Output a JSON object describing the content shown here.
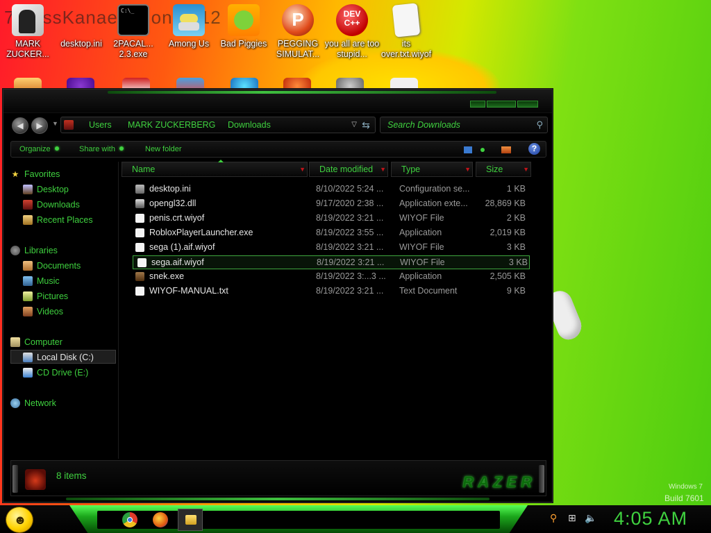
{
  "colors": {
    "accent_green": "#3fd13f",
    "window_bg": "#000000",
    "arrow_red": "#c0141a"
  },
  "background_text": "7...ossKanae ...tion 2012",
  "desktop_icons": [
    {
      "label": "MARK ZUCKER...",
      "icon": "user-folder-icon"
    },
    {
      "label": "desktop.ini",
      "icon": "cmd-icon"
    },
    {
      "label": "2PACAL... 2.3.exe",
      "icon": "terminal-icon"
    },
    {
      "label": "Among Us",
      "icon": "among-us-icon"
    },
    {
      "label": "Bad Piggies",
      "icon": "bad-piggies-icon"
    },
    {
      "label": "PEGGING SIMULAT...",
      "icon": "p-game-icon"
    },
    {
      "label": "you all are too stupid...",
      "icon": "dev-cpp-icon"
    },
    {
      "label": "its over.txt.wiyof",
      "icon": "blank-file-icon"
    }
  ],
  "nav": {
    "back": "◀",
    "forward": "▶",
    "breadcrumb": [
      "Users",
      "MARK ZUCKERBERG",
      "Downloads"
    ],
    "search_placeholder": "Search Downloads"
  },
  "toolbar": {
    "organize": "Organize",
    "share_with": "Share with",
    "new_folder": "New folder",
    "help": "?"
  },
  "sidebar": {
    "favorites": {
      "label": "Favorites",
      "items": [
        "Desktop",
        "Downloads",
        "Recent Places"
      ]
    },
    "libraries": {
      "label": "Libraries",
      "items": [
        "Documents",
        "Music",
        "Pictures",
        "Videos"
      ]
    },
    "computer": {
      "label": "Computer",
      "items": [
        "Local Disk (C:)",
        "CD Drive (E:)"
      ]
    },
    "network": {
      "label": "Network"
    }
  },
  "columns": {
    "name": "Name",
    "date": "Date modified",
    "type": "Type",
    "size": "Size"
  },
  "files": [
    {
      "name": "desktop.ini",
      "date": "8/10/2022 5:24 ...",
      "type": "Configuration se...",
      "size": "1 KB",
      "icon": "config-file-icon"
    },
    {
      "name": "opengl32.dll",
      "date": "9/17/2020 2:38 ...",
      "type": "Application exte...",
      "size": "28,869 KB",
      "icon": "dll-file-icon"
    },
    {
      "name": "penis.crt.wiyof",
      "date": "8/19/2022 3:21 ...",
      "type": "WIYOF File",
      "size": "2 KB",
      "icon": "blank-file-icon"
    },
    {
      "name": "RobloxPlayerLauncher.exe",
      "date": "8/19/2022 3:55 ...",
      "type": "Application",
      "size": "2,019 KB",
      "icon": "roblox-icon"
    },
    {
      "name": "sega (1).aif.wiyof",
      "date": "8/19/2022 3:21 ...",
      "type": "WIYOF File",
      "size": "3 KB",
      "icon": "blank-file-icon"
    },
    {
      "name": "sega.aif.wiyof",
      "date": "8/19/2022 3:21 ...",
      "type": "WIYOF File",
      "size": "3 KB",
      "icon": "blank-file-icon"
    },
    {
      "name": "snek.exe",
      "date": "8/19/2022 3:...3 ...",
      "type": "Application",
      "size": "2,505 KB",
      "icon": "exe-icon"
    },
    {
      "name": "WIYOF-MANUAL.txt",
      "date": "8/19/2022 3:21 ...",
      "type": "Text Document",
      "size": "9 KB",
      "icon": "text-file-icon"
    }
  ],
  "status": {
    "count": "8 items",
    "logo": "RAZER"
  },
  "watermark": {
    "line1": "Windows 7",
    "line2": "Build 7601"
  },
  "taskbar": {
    "time": "4:05 AM"
  }
}
